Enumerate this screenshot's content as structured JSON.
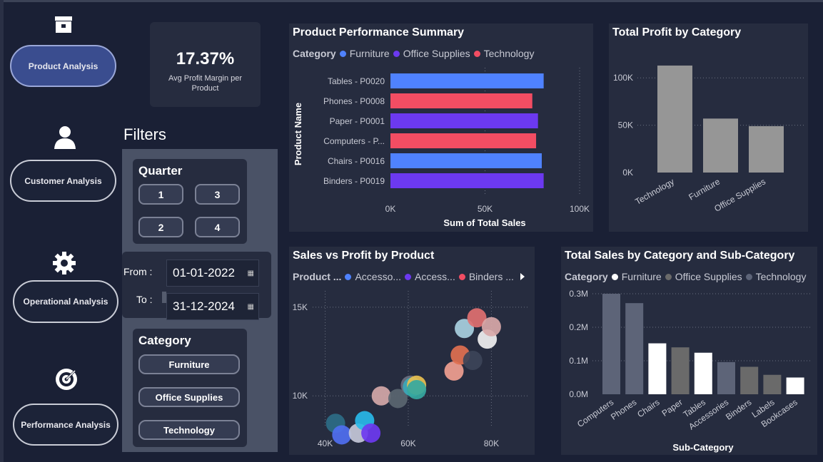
{
  "nav": {
    "items": [
      {
        "label": "Product Analysis",
        "icon": "box-icon",
        "active": true
      },
      {
        "label": "Customer Analysis",
        "icon": "user-icon",
        "active": false
      },
      {
        "label": "Operational Analysis",
        "icon": "gear-icon",
        "active": false
      },
      {
        "label": "Performance Analysis",
        "icon": "target-icon",
        "active": false
      }
    ]
  },
  "kpi": {
    "value": "17.37%",
    "label": "Avg Profit Margin per Product"
  },
  "filters": {
    "title": "Filters",
    "quarter": {
      "title": "Quarter",
      "options": [
        "1",
        "3",
        "2",
        "4"
      ]
    },
    "date_from_label": "From :",
    "date_to_label": "To :",
    "date_from": "01-01-2022",
    "date_to": "31-12-2024",
    "category": {
      "title": "Category",
      "options": [
        "Furniture",
        "Office Supplies",
        "Technology"
      ]
    }
  },
  "colors": {
    "furniture": "#4f82ff",
    "office_supplies": "#6c39f0",
    "technology": "#f24d63",
    "gray_bar": "#969696",
    "cat_furniture": "#ffffff",
    "cat_office": "#6a6a6a",
    "cat_technology": "#5d6478"
  },
  "chart_data": [
    {
      "type": "bar",
      "orientation": "horizontal",
      "title": "Product Performance Summary",
      "legend_title": "Category",
      "legend": [
        "Furniture",
        "Office Supplies",
        "Technology"
      ],
      "categories": [
        "Tables - P0020",
        "Phones - P0008",
        "Paper - P0001",
        "Computers - P...",
        "Chairs - P0016",
        "Binders - P0019"
      ],
      "values": [
        81000,
        75000,
        78000,
        77000,
        80000,
        81000
      ],
      "category_of": [
        "Furniture",
        "Technology",
        "Office Supplies",
        "Technology",
        "Furniture",
        "Office Supplies"
      ],
      "xlabel": "Sum of Total Sales",
      "ylabel": "Product Name",
      "xticks": [
        "0K",
        "50K",
        "100K"
      ],
      "xlim": [
        0,
        100000
      ],
      "grid": true
    },
    {
      "type": "bar",
      "title": "Total Profit by Category",
      "categories": [
        "Technology",
        "Furniture",
        "Office Supplies"
      ],
      "values": [
        113000,
        57000,
        49000
      ],
      "yticks": [
        "0K",
        "50K",
        "100K"
      ],
      "ylim": [
        0,
        125000
      ],
      "grid": true
    },
    {
      "type": "scatter",
      "title": "Sales vs Profit by Product",
      "legend_title": "Product ...",
      "legend": [
        "Accesso...",
        "Access...",
        "Binders ..."
      ],
      "legend_colors": [
        "#4f82ff",
        "#6c39f0",
        "#f24d63"
      ],
      "xticks": [
        "40K",
        "60K",
        "80K"
      ],
      "yticks": [
        "10K",
        "15K"
      ],
      "xlim": [
        37500,
        88000
      ],
      "ylim": [
        8200,
        16000
      ],
      "points": [
        {
          "x": 42500,
          "y": 8450,
          "c": "#2c6c86"
        },
        {
          "x": 44000,
          "y": 7800,
          "c": "#4f6ff0"
        },
        {
          "x": 48000,
          "y": 7900,
          "c": "#c4c8d8"
        },
        {
          "x": 49500,
          "y": 8600,
          "c": "#28b8e8"
        },
        {
          "x": 51000,
          "y": 7900,
          "c": "#6c39f0"
        },
        {
          "x": 53500,
          "y": 10000,
          "c": "#d4a8a8"
        },
        {
          "x": 57500,
          "y": 9850,
          "c": "#5a6670"
        },
        {
          "x": 60500,
          "y": 10600,
          "c": "#6a7080"
        },
        {
          "x": 61000,
          "y": 10500,
          "c": "#3aa8b8"
        },
        {
          "x": 62000,
          "y": 10600,
          "c": "#e8c050"
        },
        {
          "x": 62000,
          "y": 10350,
          "c": "#35a8a0"
        },
        {
          "x": 71000,
          "y": 11400,
          "c": "#f0a090"
        },
        {
          "x": 72500,
          "y": 12300,
          "c": "#e07050"
        },
        {
          "x": 73500,
          "y": 13800,
          "c": "#a8d0e0"
        },
        {
          "x": 75500,
          "y": 12000,
          "c": "#3c4458"
        },
        {
          "x": 76500,
          "y": 14400,
          "c": "#e07070"
        },
        {
          "x": 79000,
          "y": 13200,
          "c": "#f0f0f0"
        },
        {
          "x": 80000,
          "y": 13900,
          "c": "#d8a8a8"
        }
      ]
    },
    {
      "type": "bar",
      "title": "Total Sales by Category and Sub-Category",
      "legend_title": "Category",
      "legend": [
        "Furniture",
        "Office Supplies",
        "Technology"
      ],
      "categories": [
        "Computers",
        "Phones",
        "Chairs",
        "Paper",
        "Tables",
        "Accessories",
        "Binders",
        "Labels",
        "Bookcases"
      ],
      "values": [
        300000,
        272000,
        152000,
        140000,
        124000,
        96000,
        82000,
        58000,
        50000
      ],
      "category_of": [
        "Technology",
        "Technology",
        "Furniture",
        "Office Supplies",
        "Furniture",
        "Technology",
        "Office Supplies",
        "Office Supplies",
        "Furniture"
      ],
      "xlabel": "Sub-Category",
      "yticks": [
        "0.0M",
        "0.1M",
        "0.2M",
        "0.3M"
      ],
      "ylim": [
        0,
        300000
      ],
      "grid": true
    }
  ]
}
